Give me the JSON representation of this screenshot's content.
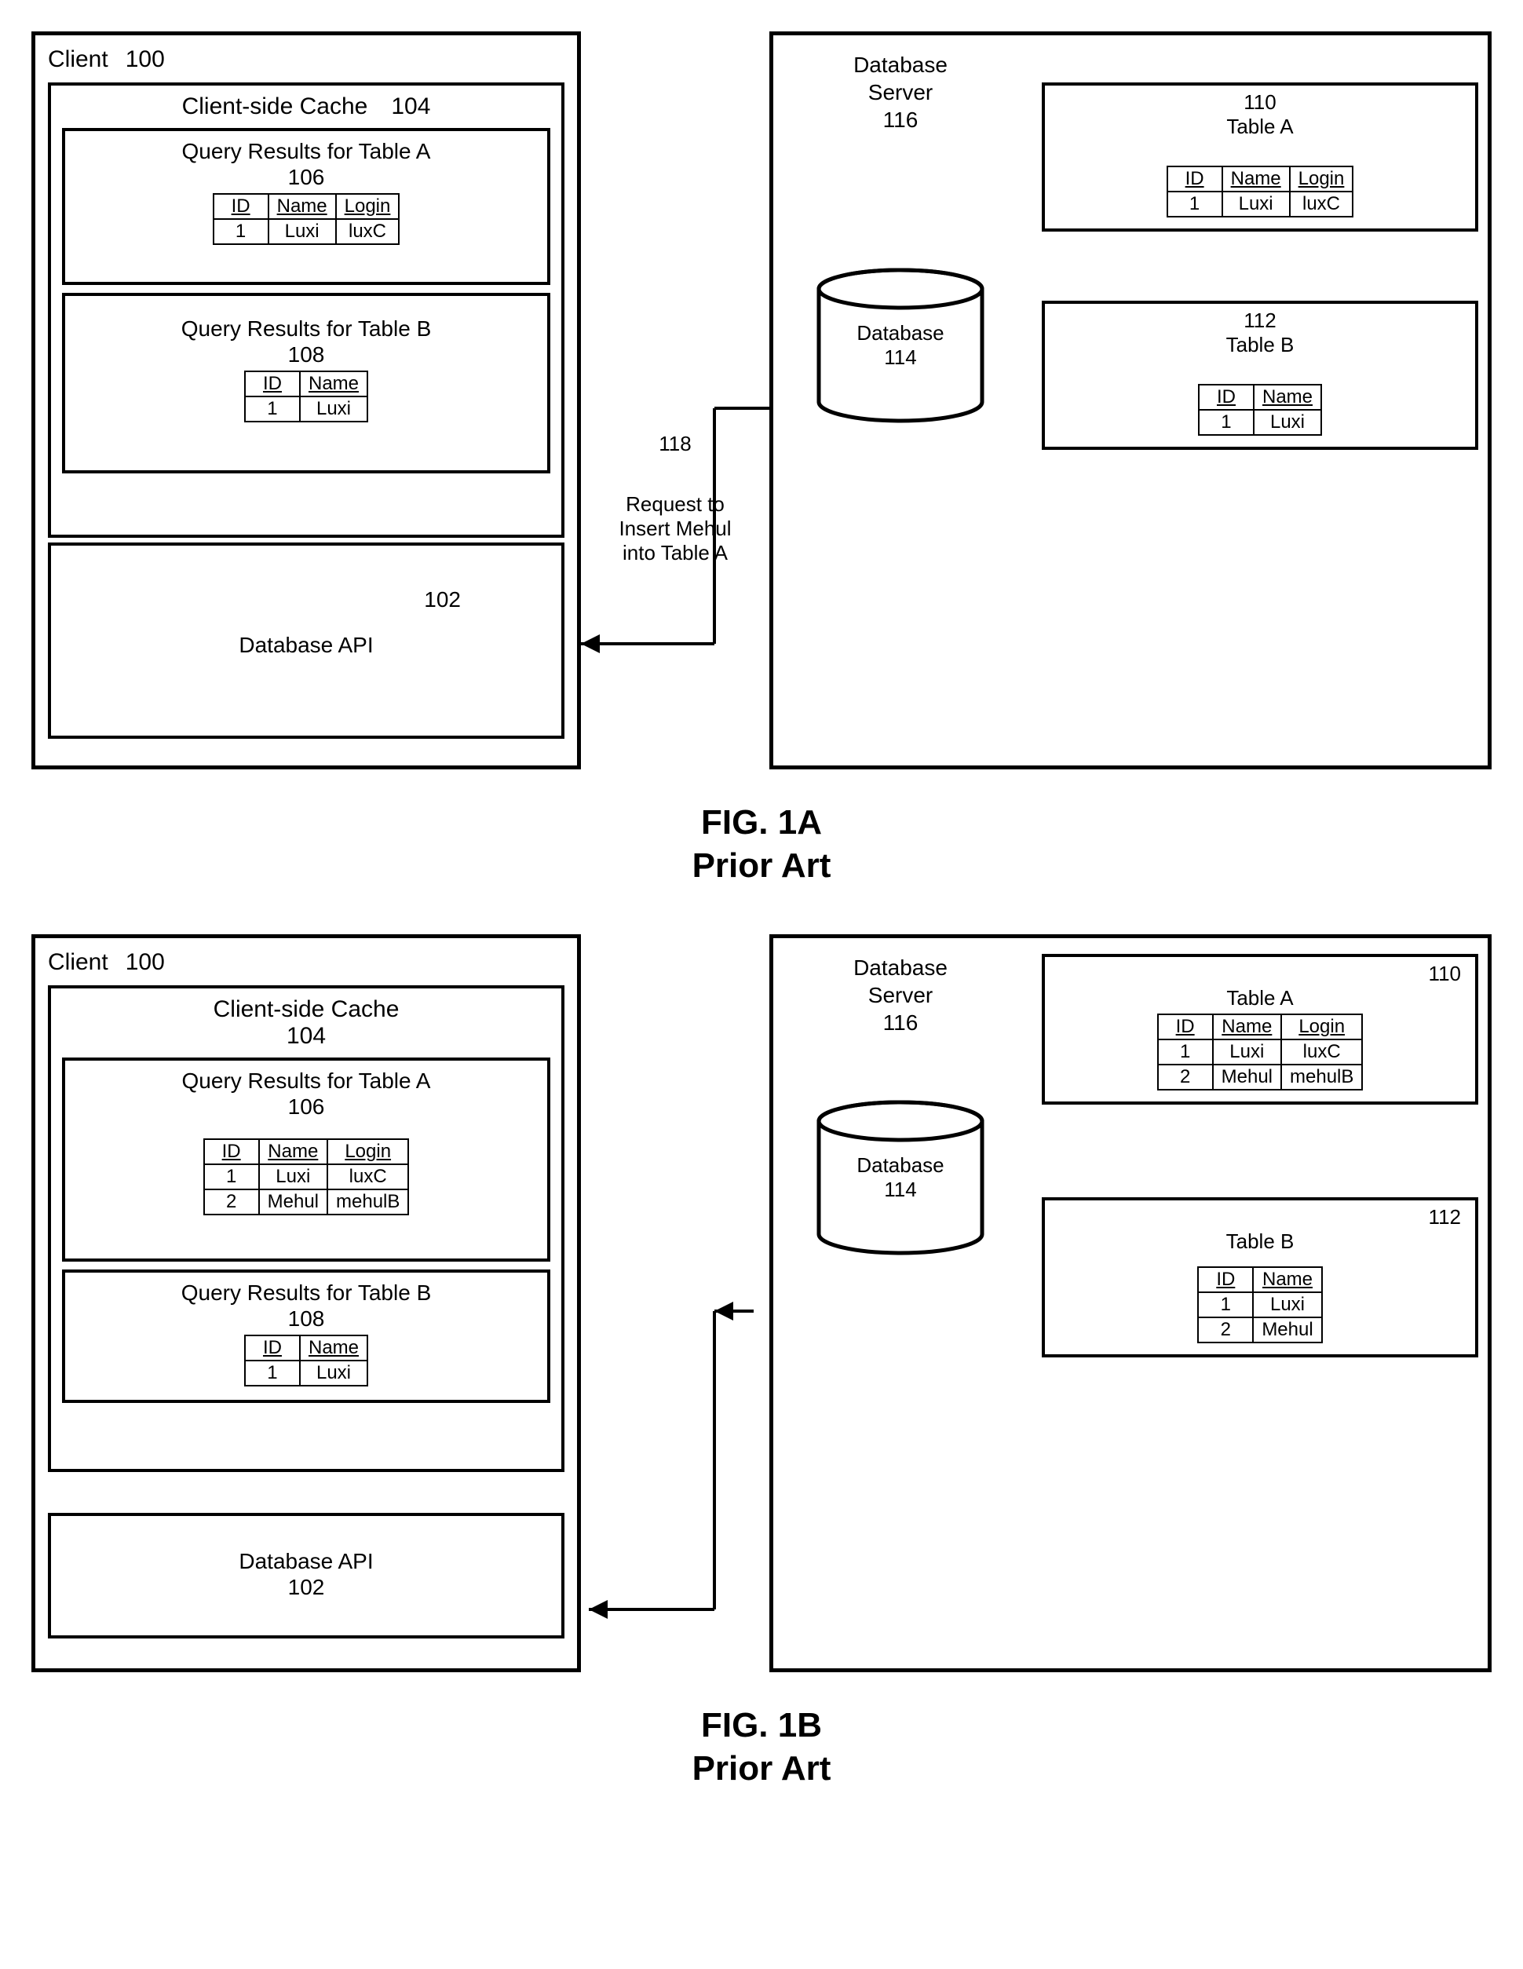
{
  "figA": {
    "caption1": "FIG. 1A",
    "caption2": "Prior Art",
    "client": {
      "title": "Client",
      "num": "100",
      "cache": {
        "title": "Client-side Cache",
        "num": "104",
        "qA": {
          "title": "Query Results for Table A",
          "num": "106",
          "headers": [
            "ID",
            "Name",
            "Login"
          ],
          "rows": [
            [
              "1",
              "Luxi",
              "luxC"
            ]
          ]
        },
        "qB": {
          "title": "Query Results for Table B",
          "num": "108",
          "headers": [
            "ID",
            "Name"
          ],
          "rows": [
            [
              "1",
              "Luxi"
            ]
          ]
        }
      },
      "api": {
        "title": "Database API",
        "num": "102"
      }
    },
    "request": {
      "num": "118",
      "text1": "Request to",
      "text2": "Insert Mehul",
      "text3": "into Table A"
    },
    "server": {
      "title1": "Database",
      "title2": "Server",
      "num": "116",
      "db": {
        "title": "Database",
        "num": "114"
      },
      "tableA": {
        "num": "110",
        "name": "Table A",
        "headers": [
          "ID",
          "Name",
          "Login"
        ],
        "rows": [
          [
            "1",
            "Luxi",
            "luxC"
          ]
        ]
      },
      "tableB": {
        "num": "112",
        "name": "Table B",
        "headers": [
          "ID",
          "Name"
        ],
        "rows": [
          [
            "1",
            "Luxi"
          ]
        ]
      }
    }
  },
  "figB": {
    "caption1": "FIG. 1B",
    "caption2": "Prior Art",
    "client": {
      "title": "Client",
      "num": "100",
      "cache": {
        "title": "Client-side Cache",
        "num": "104",
        "qA": {
          "title": "Query Results for Table A",
          "num": "106",
          "headers": [
            "ID",
            "Name",
            "Login"
          ],
          "rows": [
            [
              "1",
              "Luxi",
              "luxC"
            ],
            [
              "2",
              "Mehul",
              "mehulB"
            ]
          ]
        },
        "qB": {
          "title": "Query Results for Table B",
          "num": "108",
          "headers": [
            "ID",
            "Name"
          ],
          "rows": [
            [
              "1",
              "Luxi"
            ]
          ]
        }
      },
      "api": {
        "title": "Database API",
        "num": "102"
      }
    },
    "server": {
      "title1": "Database",
      "title2": "Server",
      "num": "116",
      "db": {
        "title": "Database",
        "num": "114"
      },
      "tableA": {
        "num": "110",
        "name": "Table A",
        "headers": [
          "ID",
          "Name",
          "Login"
        ],
        "rows": [
          [
            "1",
            "Luxi",
            "luxC"
          ],
          [
            "2",
            "Mehul",
            "mehulB"
          ]
        ]
      },
      "tableB": {
        "num": "112",
        "name": "Table B",
        "headers": [
          "ID",
          "Name"
        ],
        "rows": [
          [
            "1",
            "Luxi"
          ],
          [
            "2",
            "Mehul"
          ]
        ]
      }
    }
  }
}
